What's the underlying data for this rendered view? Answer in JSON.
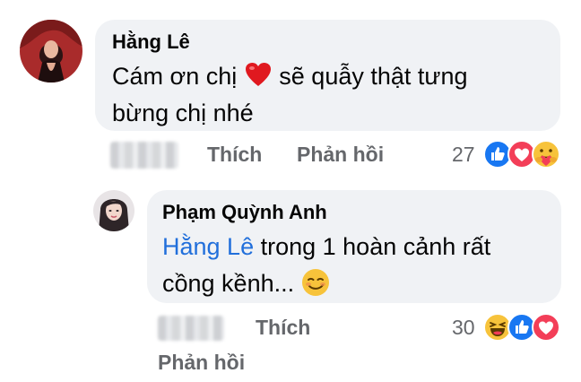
{
  "comment1": {
    "author": "Hằng Lê",
    "text_line1_a": "Cám ơn chị",
    "text_line1_b": "sẽ quẫy thật tưng",
    "text_line2": "bừng chị nhé",
    "heart_icon": "red-heart-emoji",
    "actions": {
      "like": "Thích",
      "reply": "Phản hồi"
    },
    "reaction_count": "27",
    "reactions": [
      "like",
      "love",
      "care"
    ]
  },
  "comment2": {
    "author": "Phạm Quỳnh Anh",
    "mention": "Hằng Lê",
    "text_line1": " trong 1 hoàn cảnh rất",
    "text_line2": "cồng kềnh... ",
    "emoji": "smirk-emoji",
    "actions": {
      "like": "Thích",
      "reply": "Phản hồi"
    },
    "reaction_count": "30",
    "reactions": [
      "haha",
      "like",
      "love"
    ]
  },
  "colors": {
    "bubble": "#f0f2f5",
    "text": "#050505",
    "secondary": "#65676b",
    "mention": "#216fdb",
    "like": "#1877f2",
    "love": "#f33e58"
  }
}
